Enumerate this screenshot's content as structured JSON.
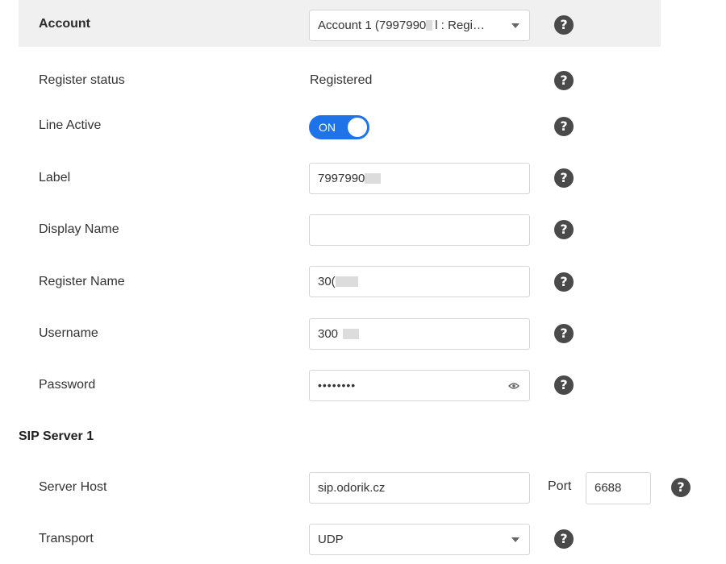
{
  "account": {
    "label": "Account",
    "select_value": "Account 1 (7997990",
    "select_value_suffix": ": Regi…"
  },
  "fields": {
    "register_status": {
      "label": "Register status",
      "value": "Registered"
    },
    "line_active": {
      "label": "Line Active",
      "toggle_text": "ON",
      "enabled": true
    },
    "label": {
      "label": "Label",
      "value": "7997990"
    },
    "display_name": {
      "label": "Display Name",
      "value": ""
    },
    "register_name": {
      "label": "Register Name",
      "value": "30("
    },
    "username": {
      "label": "Username",
      "value": "300"
    },
    "password": {
      "label": "Password",
      "value": "••••••••"
    }
  },
  "sip_server": {
    "title": "SIP Server 1",
    "server_host": {
      "label": "Server Host",
      "value": "sip.odorik.cz"
    },
    "port": {
      "label": "Port",
      "value": "6688"
    },
    "transport": {
      "label": "Transport",
      "value": "UDP"
    }
  },
  "help_symbol": "?",
  "colors": {
    "accent": "#1f73e8",
    "help_icon": "#4a4a4a",
    "account_bar": "#f0f0f0"
  }
}
